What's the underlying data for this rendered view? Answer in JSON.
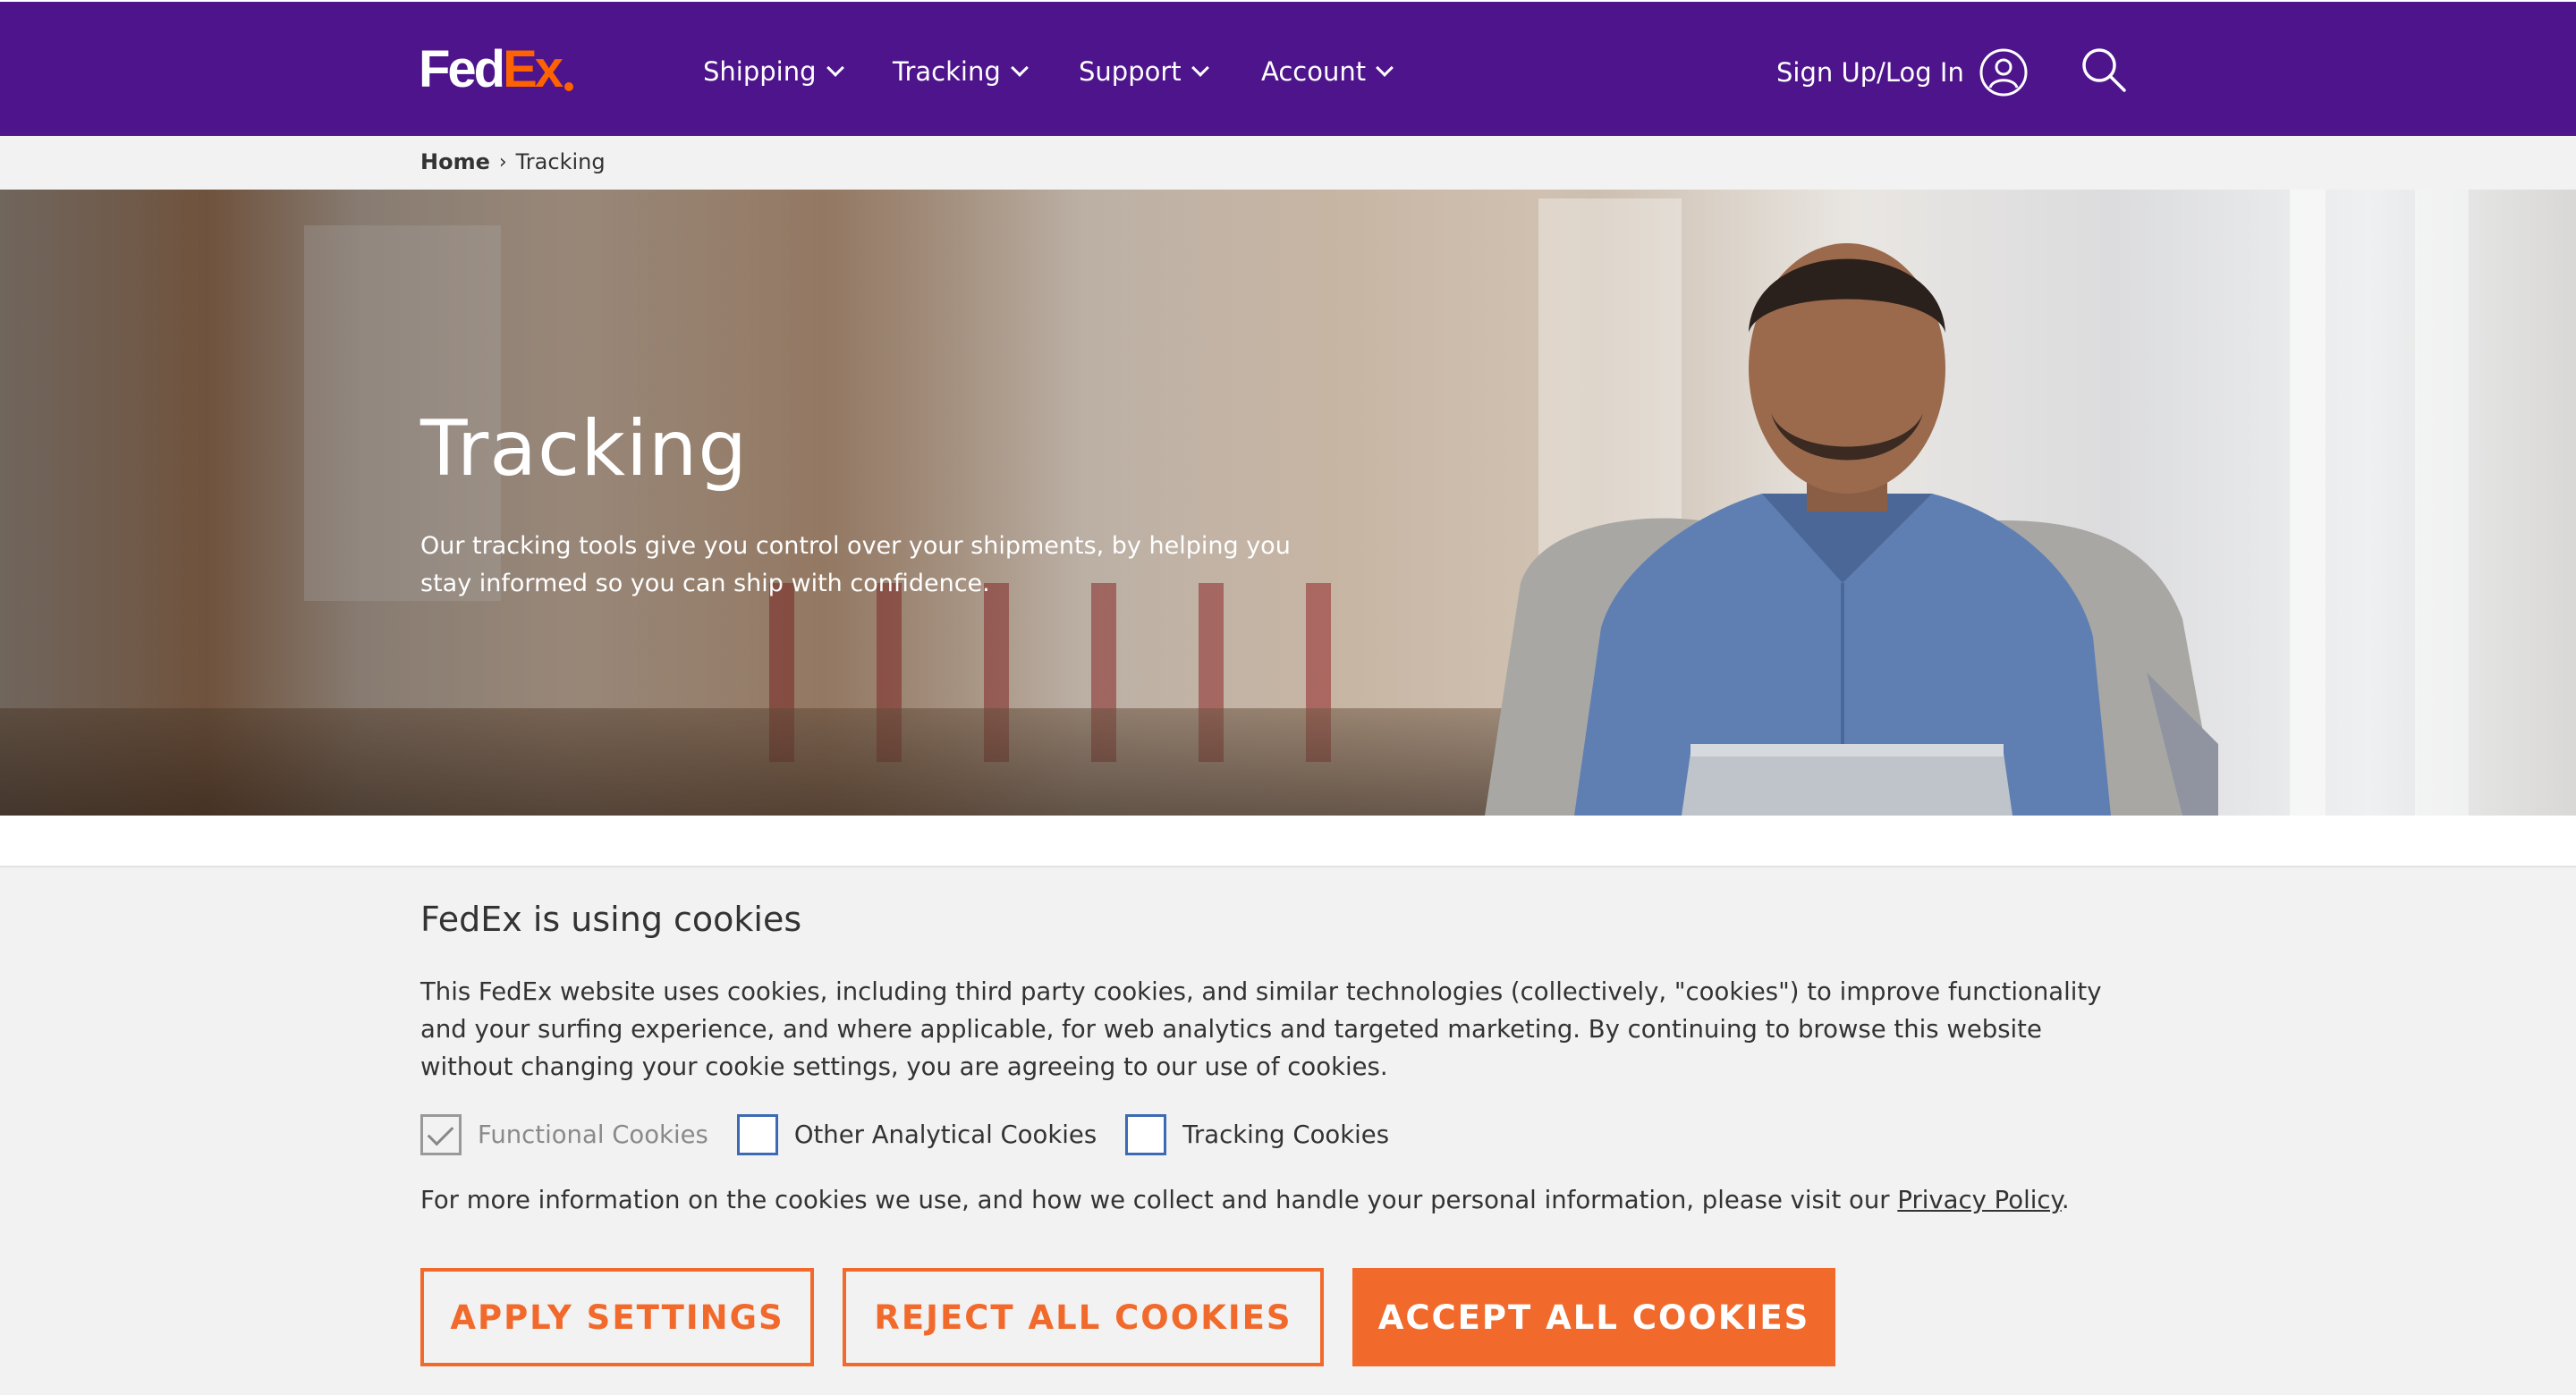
{
  "header": {
    "logo_fed": "Fed",
    "logo_ex": "Ex",
    "nav": [
      {
        "label": "Shipping"
      },
      {
        "label": "Tracking"
      },
      {
        "label": "Support"
      },
      {
        "label": "Account"
      }
    ],
    "signin_label": "Sign Up/Log In",
    "icons": {
      "user": "user-circle-icon",
      "search": "search-icon",
      "chevron": "chevron-down-icon"
    },
    "colors": {
      "brand_purple": "#4d148c",
      "brand_orange": "#ff6200"
    }
  },
  "breadcrumb": {
    "home": "Home",
    "separator": "›",
    "current": "Tracking"
  },
  "hero": {
    "title": "Tracking",
    "description": "Our tracking tools give you control over your shipments, by helping you stay informed so you can ship with confidence."
  },
  "cookie_banner": {
    "title": "FedEx is using cookies",
    "body": "This FedEx website uses cookies, including third party cookies, and similar technologies (collectively, \"cookies\") to improve functionality and your surfing experience, and where applicable, for web analytics and targeted marketing. By continuing to browse this website without changing your cookie settings, you are agreeing to our use of cookies.",
    "options": [
      {
        "label": "Functional Cookies",
        "checked": true,
        "disabled": true
      },
      {
        "label": "Other Analytical Cookies",
        "checked": false,
        "disabled": false
      },
      {
        "label": "Tracking Cookies",
        "checked": false,
        "disabled": false
      }
    ],
    "more_info_prefix": "For more information on the cookies we use, and how we collect and handle your personal information, please visit our ",
    "privacy_link": "Privacy Policy",
    "more_info_suffix": ".",
    "buttons": {
      "apply": "APPLY SETTINGS",
      "reject": "REJECT ALL COOKIES",
      "accept": "ACCEPT ALL COOKIES"
    },
    "colors": {
      "button_orange": "#f16a2b",
      "checkbox_blue": "#3d6ab5"
    }
  }
}
